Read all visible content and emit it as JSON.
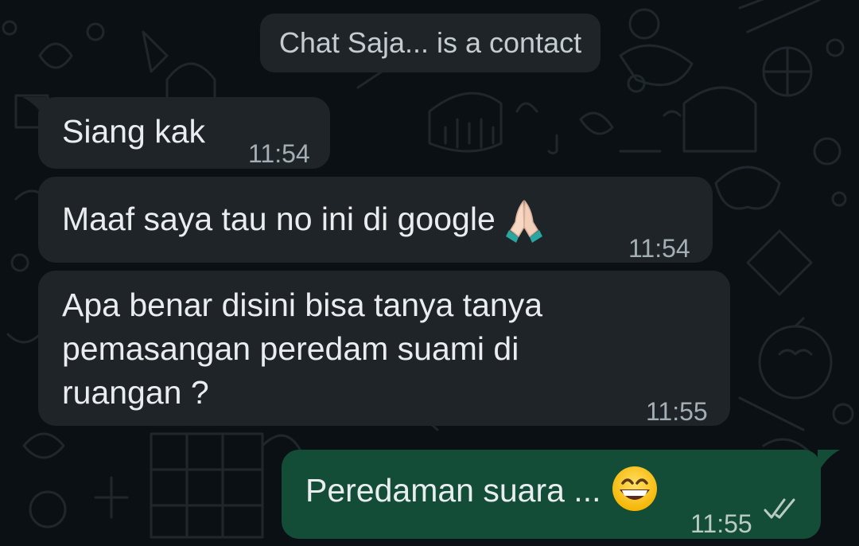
{
  "system_notice": "Chat Saja... is a contact",
  "messages": [
    {
      "direction": "incoming",
      "text": "Siang kak",
      "time": "11:54"
    },
    {
      "direction": "incoming",
      "text": "Maaf saya tau no ini di google",
      "emoji": "folded-hands-emoji",
      "time": "11:54"
    },
    {
      "direction": "incoming",
      "lines": [
        "Apa benar disini bisa tanya tanya",
        "pemasangan peredam suami di",
        "ruangan ?"
      ],
      "time": "11:55"
    },
    {
      "direction": "outgoing",
      "text": "Peredaman suara ...",
      "emoji": "grinning-face-emoji",
      "time": "11:55",
      "status": "double-check-icon"
    }
  ],
  "colors": {
    "background": "#0b1014",
    "incoming_bubble": "#1f2428",
    "outgoing_bubble": "#144d37",
    "text": "#e9edef",
    "timestamp": "#a4afb5"
  }
}
